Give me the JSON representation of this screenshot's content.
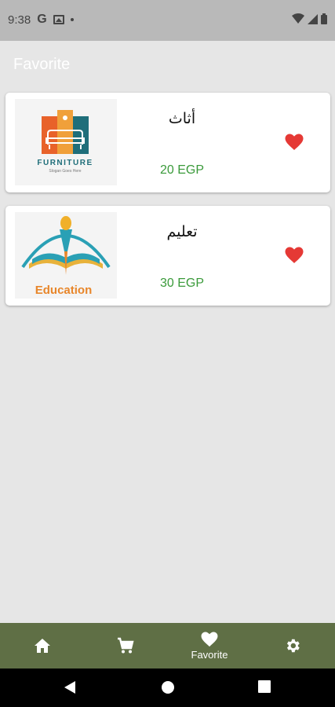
{
  "status_bar": {
    "time": "9:38",
    "left_icons": [
      "google-icon",
      "image-icon",
      "dot-icon"
    ],
    "right_icons": [
      "wifi-icon",
      "signal-icon",
      "battery-icon"
    ],
    "google_letter": "G"
  },
  "app_bar": {
    "title": "Favorite"
  },
  "favorites": [
    {
      "name": "أثاث",
      "price": "20 EGP",
      "logo_text": "FURNITURE",
      "logo_tagline": "Slogan Goes Here",
      "icon": "heart-icon"
    },
    {
      "name": "تعليم",
      "price": "30 EGP",
      "logo_text": "Education",
      "icon": "heart-icon"
    }
  ],
  "bottom_nav": {
    "items": [
      {
        "icon": "home-icon",
        "label": ""
      },
      {
        "icon": "cart-icon",
        "label": ""
      },
      {
        "icon": "heart-icon",
        "label": "Favorite"
      },
      {
        "icon": "gear-icon",
        "label": ""
      }
    ]
  },
  "colors": {
    "status_bar": "#b9b9b9",
    "background": "#e6e6e6",
    "price": "#3a9a3a",
    "heart": "#e53935",
    "bottom_nav": "#5f6f45",
    "furniture_orange": "#e8622a",
    "furniture_teal": "#1f6e7a",
    "education_teal": "#2aa0b5",
    "education_orange": "#e8862a"
  }
}
